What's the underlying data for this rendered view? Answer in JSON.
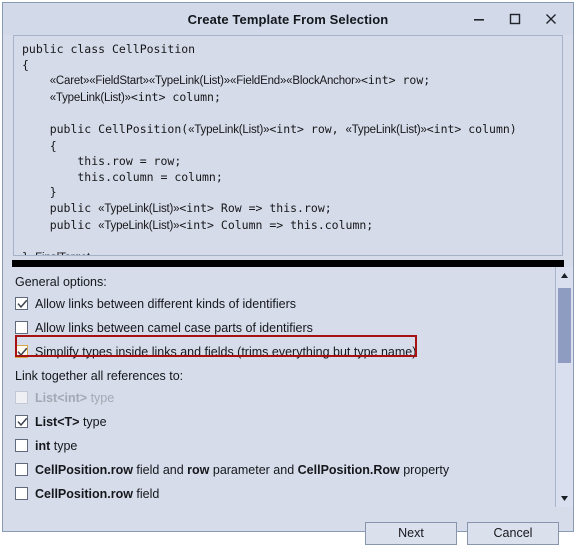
{
  "window": {
    "title": "Create Template From Selection",
    "controls": [
      {
        "name": "minimize",
        "label": "Minimize"
      },
      {
        "name": "maximize",
        "label": "Maximize"
      },
      {
        "name": "close",
        "label": "Close"
      }
    ]
  },
  "editor": {
    "lines": [
      [
        {
          "t": "code",
          "s": "public class CellPosition"
        }
      ],
      [
        {
          "t": "code",
          "s": "{"
        }
      ],
      [
        {
          "t": "code",
          "s": "    "
        },
        {
          "t": "mark",
          "s": "«Caret»«FieldStart»«TypeLink(List)»«FieldEnd»«BlockAnchor»"
        },
        {
          "t": "code",
          "s": "<int> row;"
        }
      ],
      [
        {
          "t": "code",
          "s": "    "
        },
        {
          "t": "mark",
          "s": "«TypeLink(List)»"
        },
        {
          "t": "code",
          "s": "<int> column;"
        }
      ],
      [
        {
          "t": "blank",
          "s": ""
        }
      ],
      [
        {
          "t": "code",
          "s": "    public CellPosition("
        },
        {
          "t": "mark",
          "s": "«TypeLink(List)»"
        },
        {
          "t": "code",
          "s": "<int> row, "
        },
        {
          "t": "mark",
          "s": "«TypeLink(List)»"
        },
        {
          "t": "code",
          "s": "<int> column)"
        }
      ],
      [
        {
          "t": "code",
          "s": "    {"
        }
      ],
      [
        {
          "t": "code",
          "s": "        this.row = row;"
        }
      ],
      [
        {
          "t": "code",
          "s": "        this.column = column;"
        }
      ],
      [
        {
          "t": "code",
          "s": "    }"
        }
      ],
      [
        {
          "t": "code",
          "s": "    public "
        },
        {
          "t": "mark",
          "s": "«TypeLink(List)»"
        },
        {
          "t": "code",
          "s": "<int> Row => this.row;"
        }
      ],
      [
        {
          "t": "code",
          "s": "    public "
        },
        {
          "t": "mark",
          "s": "«TypeLink(List)»"
        },
        {
          "t": "code",
          "s": "<int> Column => this.column;"
        }
      ],
      [
        {
          "t": "blank",
          "s": ""
        }
      ],
      [
        {
          "t": "code",
          "s": "}"
        },
        {
          "t": "mark",
          "s": "«FinalTarget»"
        }
      ]
    ]
  },
  "options": {
    "general_label": "General options:",
    "general_items": [
      {
        "label": "Allow links between different kinds of identifiers",
        "checked": true,
        "highlighted": false,
        "disabled": false,
        "name": "allow-links-different-kinds"
      },
      {
        "label": "Allow links between camel case parts of identifiers",
        "checked": false,
        "highlighted": false,
        "disabled": false,
        "name": "allow-links-camel-case"
      },
      {
        "label": "Simplify types inside links and fields (trims everything but type name)",
        "checked": true,
        "highlighted": true,
        "disabled": false,
        "name": "simplify-types-inside-links"
      }
    ],
    "link_label": "Link together all references to:",
    "link_items": [
      {
        "parts": [
          {
            "b": true,
            "s": "List<int>"
          },
          {
            "b": false,
            "s": " type"
          }
        ],
        "checked": false,
        "disabled": true,
        "name": "link-list-int-type"
      },
      {
        "parts": [
          {
            "b": true,
            "s": "List<T>"
          },
          {
            "b": false,
            "s": " type"
          }
        ],
        "checked": true,
        "disabled": false,
        "name": "link-list-t-type"
      },
      {
        "parts": [
          {
            "b": true,
            "s": "int"
          },
          {
            "b": false,
            "s": " type"
          }
        ],
        "checked": false,
        "disabled": false,
        "name": "link-int-type"
      },
      {
        "parts": [
          {
            "b": true,
            "s": "CellPosition.row"
          },
          {
            "b": false,
            "s": " field and "
          },
          {
            "b": true,
            "s": "row"
          },
          {
            "b": false,
            "s": " parameter and "
          },
          {
            "b": true,
            "s": "CellPosition.Row"
          },
          {
            "b": false,
            "s": " property"
          }
        ],
        "checked": false,
        "disabled": false,
        "name": "link-cellposition-row-field-param-property"
      },
      {
        "parts": [
          {
            "b": true,
            "s": "CellPosition.row"
          },
          {
            "b": false,
            "s": " field"
          }
        ],
        "checked": false,
        "disabled": false,
        "name": "link-cellposition-row-field"
      }
    ]
  },
  "scrollbar": {
    "up_arrow": "scroll-up",
    "down_arrow": "scroll-down"
  },
  "footer": {
    "next_label": "Next",
    "cancel_label": "Cancel"
  },
  "colors": {
    "dialog_background": "#d6dcea",
    "titlebar": "#d2d9e9",
    "editor_background": "#d5dbe9",
    "highlight_red": "#a81111",
    "scroll_thumb": "#8e9cc2",
    "separator": "#000000"
  }
}
